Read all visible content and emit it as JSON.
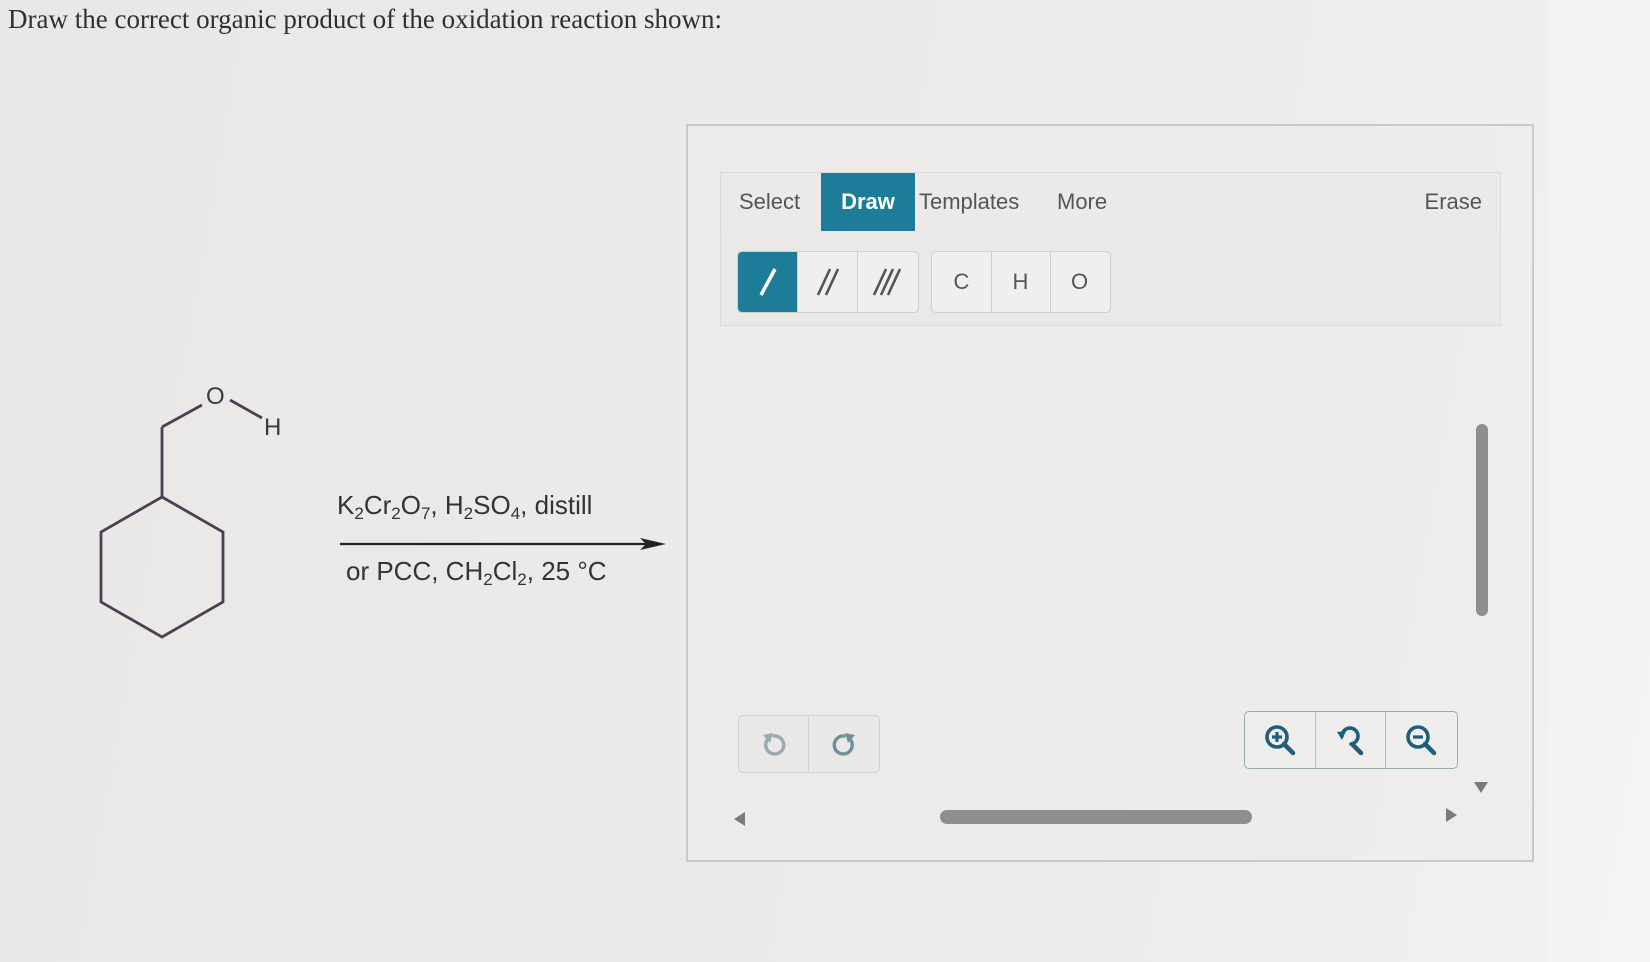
{
  "question": {
    "text": "Draw the correct organic product of the oxidation reaction shown:"
  },
  "reactant": {
    "o_label": "O",
    "h_label": "H"
  },
  "reagents": {
    "top": {
      "k": "K",
      "k_sub": "2",
      "cr": "Cr",
      "cr_sub": "2",
      "o": "O",
      "o_sub": "7",
      "sep1": ", H",
      "h_sub": "2",
      "so": "SO",
      "so_sub": "4",
      "tail": ", distill"
    },
    "bottom": {
      "lead": "or PCC, CH",
      "ch_sub": "2",
      "cl": "Cl",
      "cl_sub": "2",
      "tail": ", 25 °C"
    }
  },
  "sketcher": {
    "tabs": {
      "select": "Select",
      "draw": "Draw",
      "templates": "Templates",
      "more": "More",
      "erase": "Erase"
    },
    "active_tab": "Draw",
    "atoms": {
      "c": "C",
      "h": "H",
      "o": "O"
    },
    "bond_tools": [
      "single-bond",
      "double-bond",
      "triple-bond"
    ],
    "active_bond": "single-bond",
    "accent_color": "#1d7d99"
  }
}
